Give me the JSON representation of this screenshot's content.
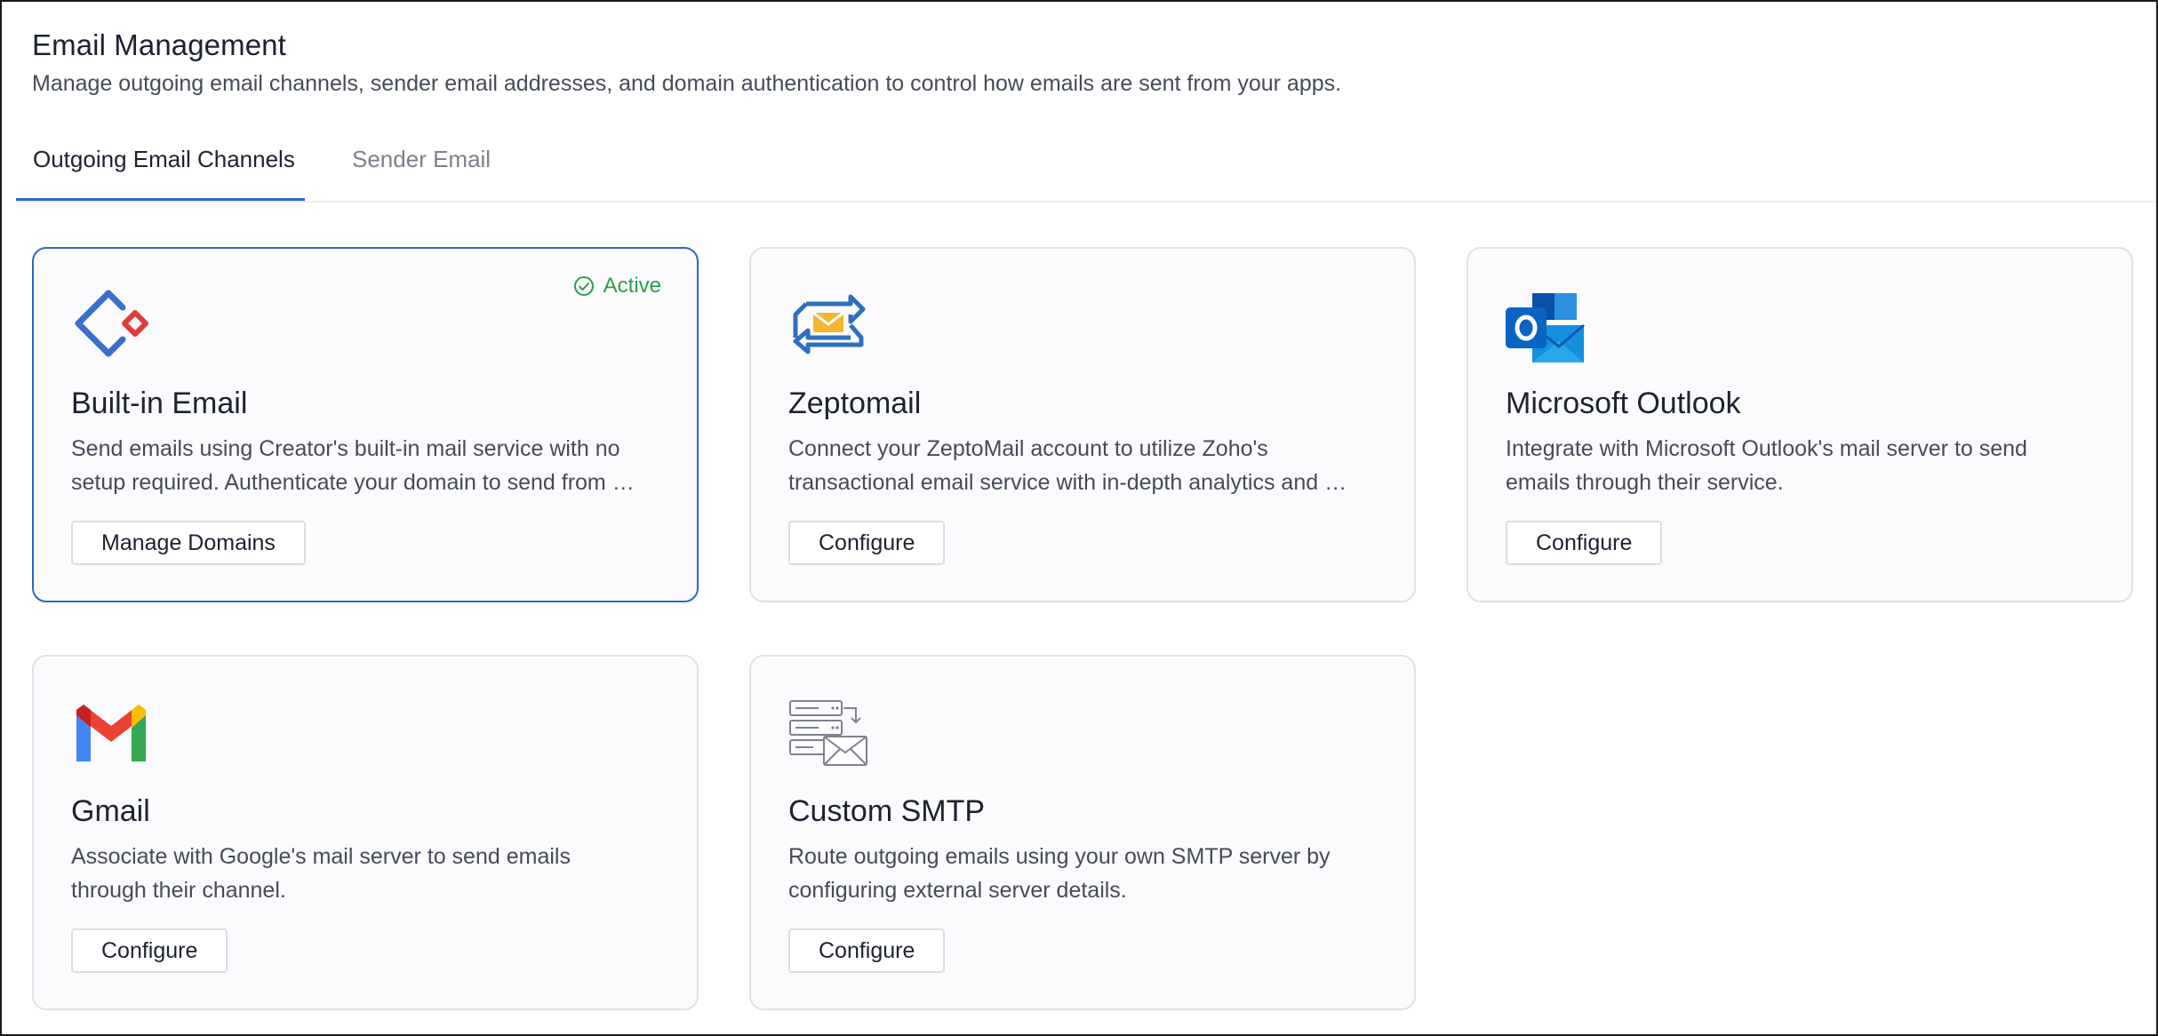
{
  "header": {
    "title": "Email Management",
    "subtitle": "Manage outgoing email channels, sender email addresses, and domain authentication to control how emails are sent from your apps."
  },
  "tabs": [
    {
      "label": "Outgoing Email Channels",
      "active": true
    },
    {
      "label": "Sender Email",
      "active": false
    }
  ],
  "cards": [
    {
      "name": "Built-in Email",
      "description": "Send emails using Creator's built-in mail service with no setup required. Authenticate your domain to send from …",
      "button": "Manage Domains",
      "status": "Active",
      "icon": "zoho-creator-icon"
    },
    {
      "name": "Zeptomail",
      "description": "Connect your ZeptoMail account to utilize Zoho's transactional email service with in-depth analytics and …",
      "button": "Configure",
      "icon": "zeptomail-icon"
    },
    {
      "name": "Microsoft Outlook",
      "description": "Integrate with Microsoft Outlook's mail server to send emails through their service.",
      "button": "Configure",
      "icon": "outlook-icon"
    },
    {
      "name": "Gmail",
      "description": "Associate with Google's mail server to send emails through their channel.",
      "button": "Configure",
      "icon": "gmail-icon"
    },
    {
      "name": "Custom SMTP",
      "description": "Route outgoing emails using your own SMTP server by configuring external server details.",
      "button": "Configure",
      "icon": "smtp-server-icon"
    }
  ],
  "colors": {
    "accent": "#2f67c6",
    "active_status": "#2e9d47"
  }
}
